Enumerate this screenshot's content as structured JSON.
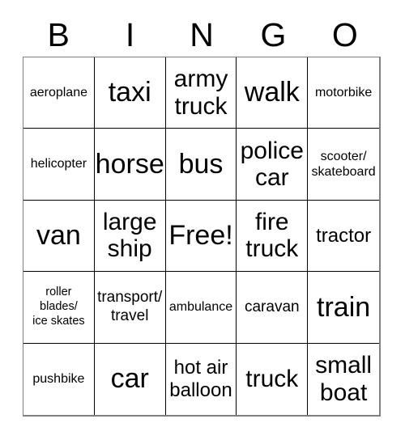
{
  "card": {
    "title": "BINGO",
    "header_letters": [
      "B",
      "I",
      "N",
      "G",
      "O"
    ],
    "border_color": "#000000",
    "text_color": "#000000",
    "background_color": "#ffffff",
    "free_space": "Free!",
    "rows": 5,
    "columns": 5,
    "cells": [
      {
        "text": "aeroplane",
        "size": "s-sm"
      },
      {
        "text": "taxi",
        "size": "s-xxl"
      },
      {
        "text": "army\ntruck",
        "size": "s-xl"
      },
      {
        "text": "walk",
        "size": "s-xxl"
      },
      {
        "text": "motorbike",
        "size": "s-sm"
      },
      {
        "text": "helicopter",
        "size": "s-sm"
      },
      {
        "text": "horse",
        "size": "s-xxl"
      },
      {
        "text": "bus",
        "size": "s-xxl"
      },
      {
        "text": "police\ncar",
        "size": "s-xl"
      },
      {
        "text": "scooter/\nskateboard",
        "size": "s-sm"
      },
      {
        "text": "van",
        "size": "s-xxl"
      },
      {
        "text": "large\nship",
        "size": "s-xl"
      },
      {
        "text": "Free!",
        "size": "s-xxl"
      },
      {
        "text": "fire\ntruck",
        "size": "s-xl"
      },
      {
        "text": "tractor",
        "size": "s-lg"
      },
      {
        "text": "roller\nblades/\nice skates",
        "size": "s-xs"
      },
      {
        "text": "transport/\ntravel",
        "size": "s-md"
      },
      {
        "text": "ambulance",
        "size": "s-sm"
      },
      {
        "text": "caravan",
        "size": "s-md"
      },
      {
        "text": "train",
        "size": "s-xxl"
      },
      {
        "text": "pushbike",
        "size": "s-sm"
      },
      {
        "text": "car",
        "size": "s-xxl"
      },
      {
        "text": "hot air\nballoon",
        "size": "s-lg"
      },
      {
        "text": "truck",
        "size": "s-xl"
      },
      {
        "text": "small\nboat",
        "size": "s-xl"
      }
    ]
  }
}
